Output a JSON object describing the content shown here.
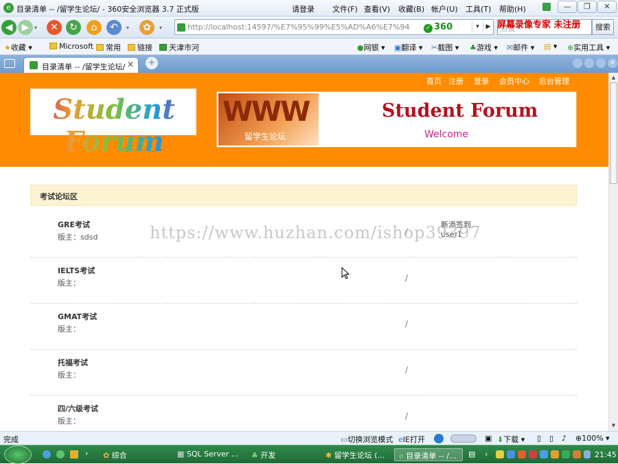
{
  "window": {
    "title": "目录清单 -- /留学生论坛/ - 360安全浏览器 3.7 正式版",
    "login": "请登录",
    "menu": [
      "文件(F)",
      "查看(V)",
      "收藏(B)",
      "帐户(U)",
      "工具(T)",
      "帮助(H)"
    ]
  },
  "navbar": {
    "url": "http://localhost:14597/%E7%95%99%E5%AD%A6%E7%94",
    "brand": "360",
    "search_btn": "搜索",
    "search_placeholder": "百度"
  },
  "overlay_top": "屏幕录像专家 未注册",
  "bookmarks": {
    "items": [
      "收藏",
      "Microsoft",
      "常用",
      "链接",
      "天津市河"
    ],
    "tools": [
      "网银",
      "翻译",
      "截图",
      "游戏",
      "邮件",
      "实用工具"
    ]
  },
  "tab": {
    "label": "目录清单 -- /留学生论坛/"
  },
  "site": {
    "toplinks": [
      "首页",
      "注册",
      "登录",
      "会员中心",
      "后台管理"
    ],
    "logo_text": "Student Forum",
    "banner_www": "WWW",
    "banner_zh": "留学生论坛",
    "banner_title": "Student Forum",
    "banner_sub": "Welcome",
    "section_title": "考试论坛区",
    "forums": [
      {
        "name": "GRE考试",
        "moderator": "版主：sdsd",
        "slash": "/",
        "newpost": "新添签到",
        "newuser": "user1"
      },
      {
        "name": "IELTS考试",
        "moderator": "版主：",
        "slash": "/",
        "newpost": "",
        "newuser": ""
      },
      {
        "name": "GMAT考试",
        "moderator": "版主：",
        "slash": "/",
        "newpost": "",
        "newuser": ""
      },
      {
        "name": "托福考试",
        "moderator": "版主：",
        "slash": "/",
        "newpost": "",
        "newuser": ""
      },
      {
        "name": "四/六级考试",
        "moderator": "版主：",
        "slash": "/",
        "newpost": "",
        "newuser": ""
      }
    ]
  },
  "watermark": "https://www.huzhan.com/ishop39397",
  "status": {
    "left": "完成",
    "switch_mode": "切换浏览模式",
    "ie_open": "IE打开",
    "download": "下载",
    "zoom": "100%"
  },
  "taskbar": {
    "items": [
      "综合",
      "SQL Server ...",
      "开发",
      "留学生论坛 (...",
      "目录清单 -- /..."
    ],
    "active_index": 4,
    "clock": "21:45"
  },
  "colors": {
    "header": "#ff8c00",
    "section_bg": "#fbf3d2",
    "taskbar": "#2f8a4a"
  }
}
